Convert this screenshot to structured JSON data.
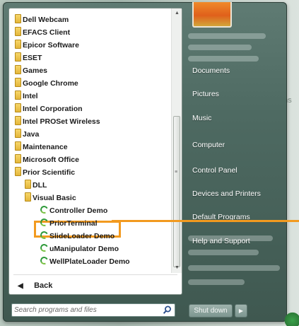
{
  "programs": [
    {
      "label": "Dell Webcam",
      "icon": "folder-icon",
      "indent": 0
    },
    {
      "label": "EFACS Client",
      "icon": "folder-icon",
      "indent": 0
    },
    {
      "label": "Epicor Software",
      "icon": "folder-icon",
      "indent": 0
    },
    {
      "label": "ESET",
      "icon": "folder-icon",
      "indent": 0
    },
    {
      "label": "Games",
      "icon": "folder-icon",
      "indent": 0
    },
    {
      "label": "Google Chrome",
      "icon": "folder-icon",
      "indent": 0
    },
    {
      "label": "Intel",
      "icon": "folder-icon",
      "indent": 0
    },
    {
      "label": "Intel Corporation",
      "icon": "folder-icon",
      "indent": 0
    },
    {
      "label": "Intel PROSet Wireless",
      "icon": "folder-icon",
      "indent": 0
    },
    {
      "label": "Java",
      "icon": "folder-icon",
      "indent": 0
    },
    {
      "label": "Maintenance",
      "icon": "folder-icon",
      "indent": 0
    },
    {
      "label": "Microsoft Office",
      "icon": "folder-icon",
      "indent": 0
    },
    {
      "label": "Prior Scientific",
      "icon": "folder-icon",
      "indent": 0
    },
    {
      "label": "DLL",
      "icon": "folder-icon",
      "indent": 1
    },
    {
      "label": "Visual Basic",
      "icon": "folder-icon",
      "indent": 1
    },
    {
      "label": "Controller Demo",
      "icon": "program-icon",
      "indent": 2
    },
    {
      "label": "PriorTerminal",
      "icon": "program-icon",
      "indent": 2,
      "highlighted": true
    },
    {
      "label": "SlideLoader Demo",
      "icon": "program-icon",
      "indent": 2
    },
    {
      "label": "uManipulator Demo",
      "icon": "program-icon",
      "indent": 2
    },
    {
      "label": "WellPlateLoader Demo",
      "icon": "program-icon",
      "indent": 2
    }
  ],
  "back_label": "Back",
  "search": {
    "placeholder": "Search programs and files"
  },
  "right_items": [
    {
      "label": "Documents"
    },
    {
      "label": "Pictures"
    },
    {
      "label": "Music"
    },
    {
      "label": "Computer"
    },
    {
      "label": "Control Panel"
    },
    {
      "label": "Devices and Printers"
    },
    {
      "label": "Default Programs"
    },
    {
      "label": "Help and Support"
    }
  ],
  "shutdown_label": "Shut down",
  "background_text": "nns",
  "colors": {
    "highlight": "#f29a1f",
    "menu_bg": "#4e6a62"
  }
}
